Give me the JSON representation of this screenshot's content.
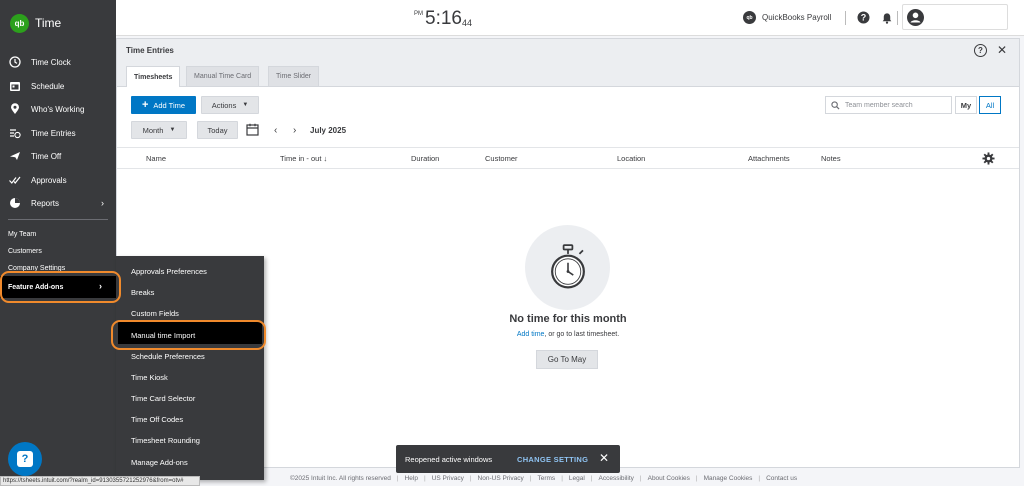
{
  "app": {
    "name": "Time",
    "logo_text": "qb"
  },
  "sidebar": {
    "items": [
      {
        "label": "Time Clock",
        "icon": "clock-icon"
      },
      {
        "label": "Schedule",
        "icon": "calendar-icon"
      },
      {
        "label": "Who's Working",
        "icon": "location-pin-icon"
      },
      {
        "label": "Time Entries",
        "icon": "time-entries-icon"
      },
      {
        "label": "Time Off",
        "icon": "airplane-icon"
      },
      {
        "label": "Approvals",
        "icon": "checkmarks-icon"
      },
      {
        "label": "Reports",
        "icon": "pie-chart-icon"
      }
    ],
    "sub_items": [
      "My Team",
      "Customers",
      "Company Settings"
    ],
    "feature_addons": "Feature Add-ons"
  },
  "header": {
    "clock": {
      "ampm": "PM",
      "time": "5:16",
      "seconds": "44"
    },
    "payroll_label": "QuickBooks Payroll"
  },
  "panel": {
    "title": "Time Entries",
    "tabs": [
      "Timesheets",
      "Manual Time Card",
      "Time Slider"
    ],
    "active_tab": "Timesheets",
    "add_time_label": "Add Time",
    "actions_label": "Actions",
    "month_label": "Month",
    "today_label": "Today",
    "period": "July 2025",
    "search_placeholder": "Team member search",
    "seg_my": "My",
    "seg_all": "All",
    "columns": [
      "Name",
      "Time in - out",
      "Duration",
      "Customer",
      "Location",
      "Attachments",
      "Notes"
    ],
    "empty": {
      "title": "No time for this month",
      "link": "Add time",
      "rest": ", or go to last timesheet.",
      "button": "Go To May"
    }
  },
  "flyout": {
    "items": [
      "Approvals Preferences",
      "Breaks",
      "Custom Fields",
      "Manual time Import",
      "Schedule Preferences",
      "Time Kiosk",
      "Time Card Selector",
      "Time Off Codes",
      "Timesheet Rounding",
      "Manage Add-ons"
    ],
    "highlighted": "Manual time Import"
  },
  "toast": {
    "message": "Reopened active windows",
    "action": "CHANGE SETTING"
  },
  "footer": {
    "links": [
      "©2025 Intuit Inc. All rights reserved",
      "Help",
      "US Privacy",
      "Non-US Privacy",
      "Terms",
      "Legal",
      "Accessibility",
      "About Cookies",
      "Manage Cookies",
      "Contact us"
    ]
  },
  "status_url": "https://tsheets.intuit.com/?realm_id=9130355721252976&from=otv#",
  "colors": {
    "brand_green": "#2ca01c",
    "accent_blue": "#0077c5",
    "annotation_orange": "#f08a2c",
    "sidebar_bg": "#393a3d"
  }
}
